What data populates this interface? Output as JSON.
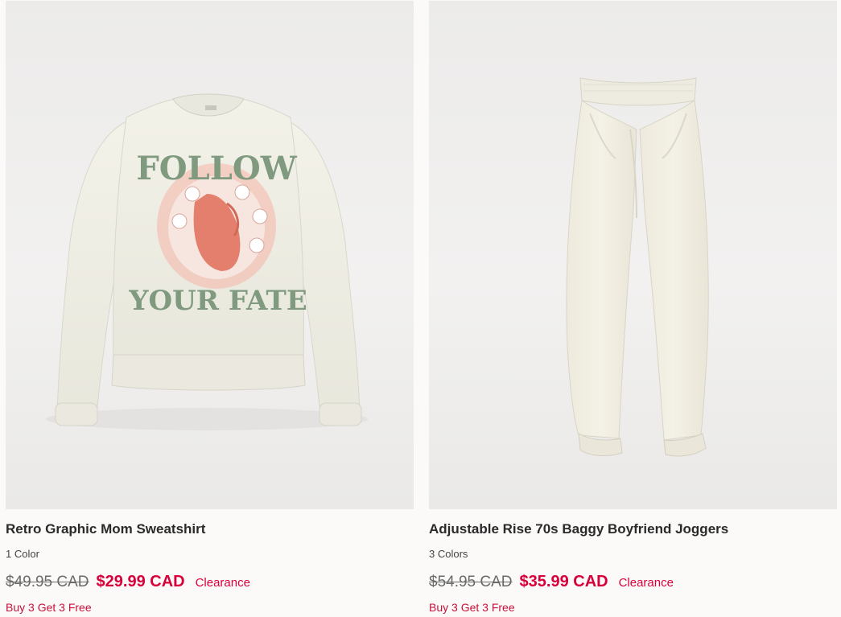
{
  "products": [
    {
      "title": "Retro Graphic Mom Sweatshirt",
      "colors": "1 Color",
      "original_price": "$49.95 CAD",
      "sale_price": "$29.99 CAD",
      "badge": "Clearance",
      "promo": "Buy 3 Get 3 Free",
      "image": {
        "subject": "sweatshirt",
        "print_top": "FOLLOW",
        "print_bottom": "YOUR FATE"
      }
    },
    {
      "title": "Adjustable Rise 70s Baggy Boyfriend Joggers",
      "colors": "3 Colors",
      "original_price": "$54.95 CAD",
      "sale_price": "$35.99 CAD",
      "badge": "Clearance",
      "promo": "Buy 3 Get 3 Free",
      "image": {
        "subject": "joggers"
      }
    }
  ],
  "theme": {
    "sale_color": "#d8003a",
    "garment_color": "#efede2",
    "print_green": "#7f9a7e",
    "print_coral": "#e47f6e"
  }
}
